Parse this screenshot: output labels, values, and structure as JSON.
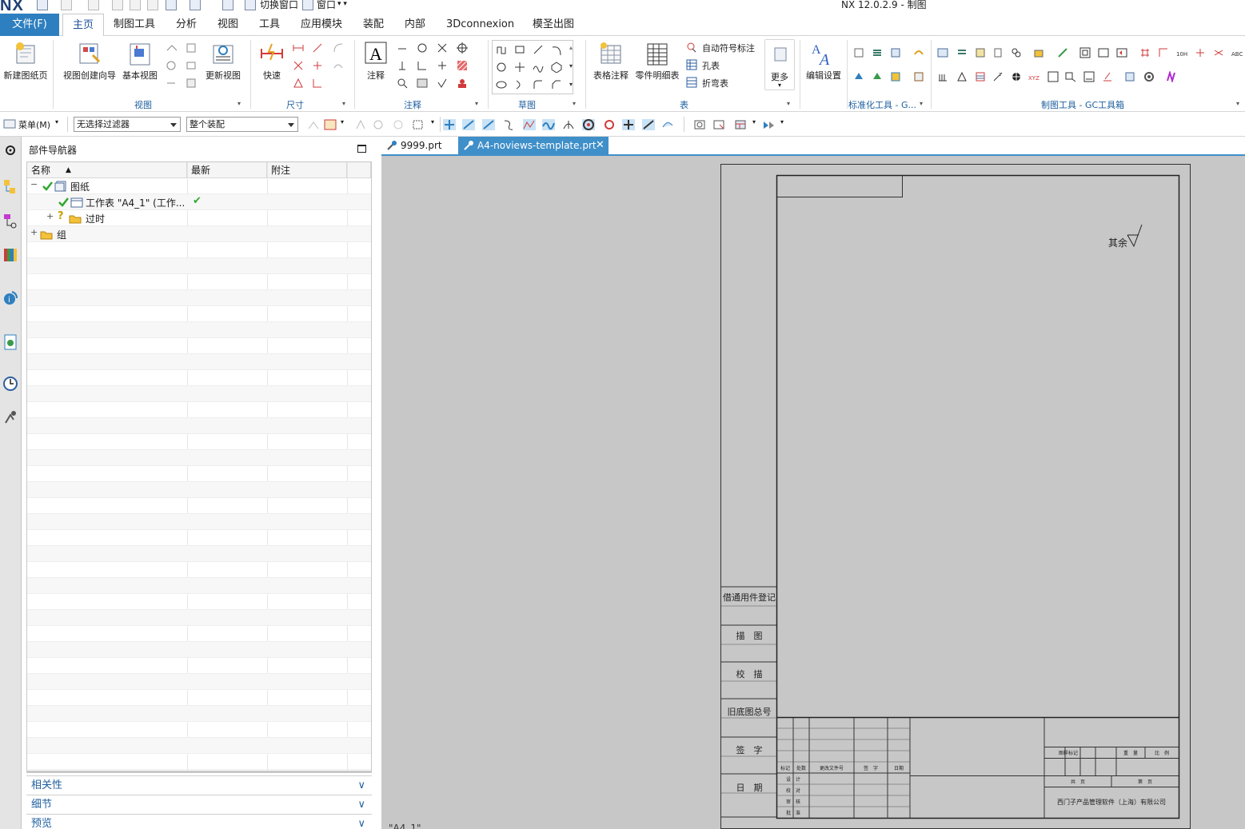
{
  "app": {
    "logo": "NX",
    "title": "NX 12.0.2.9 - 制图",
    "quick_access": {
      "switch_window": "切换窗口",
      "window": "窗口"
    }
  },
  "tabs": [
    "主页",
    "制图工具",
    "分析",
    "视图",
    "工具",
    "应用模块",
    "装配",
    "内部",
    "3Dconnexion",
    "模圣出图"
  ],
  "file_tab": "文件(F)",
  "active_tab": "主页",
  "ribbon": {
    "new_sheet": "新建图纸页",
    "view_wizard": "视图创建向导",
    "base_view": "基本视图",
    "update_view": "更新视图",
    "group_view": "视图",
    "quick_dim": "快速",
    "group_dim": "尺寸",
    "note": "注释",
    "group_annotation": "注释",
    "group_sketch": "草图",
    "table_note": "表格注释",
    "parts_list": "零件明细表",
    "auto_balloon": "自动符号标注",
    "hole_table": "孔表",
    "bend_table": "折弯表",
    "more": "更多",
    "group_table": "表",
    "edit_settings": "编辑设置",
    "group_std": "标准化工具 - G...",
    "group_gc": "制图工具 - GC工具箱"
  },
  "toolbar": {
    "menu": "菜单(M)",
    "filter": "无选择过滤器",
    "assembly": "整个装配"
  },
  "navigator": {
    "title": "部件导航器",
    "columns": [
      "名称",
      "最新",
      "附注"
    ],
    "tree": [
      {
        "label": "图纸",
        "check": true
      },
      {
        "label": "工作表 \"A4_1\" (工作...",
        "check": true,
        "latest": "✔"
      },
      {
        "label": "过时"
      },
      {
        "label": "组"
      }
    ],
    "panels": [
      "相关性",
      "细节",
      "预览"
    ]
  },
  "documents": [
    "9999.prt",
    "A4-noviews-template.prt"
  ],
  "active_document": "A4-noviews-template.prt",
  "sheet_name": "\"A4_1\"",
  "drawing": {
    "roughness_label": "其余",
    "side_labels": [
      "借通用件登记",
      "描　图",
      "校　描",
      "旧底图总号",
      "签　字",
      "日　期"
    ],
    "revision_headers": [
      "标记",
      "处数",
      "更改文件号",
      "签　字",
      "日期"
    ],
    "approval_labels": [
      "设　计",
      "校　对",
      "审　核",
      "批　准"
    ],
    "info_headers": [
      "图样标记",
      "重　量",
      "比　例"
    ],
    "sheet_count": [
      "共　页",
      "第　页"
    ],
    "company": "西门子产品管理软件（上海）有限公司"
  },
  "colors": {
    "accent": "#2e7fbf",
    "tab_text": "#1d4f9a",
    "group_label": "#1f5f9f",
    "canvas": "#c7c7c7",
    "check": "#2fa82f"
  }
}
